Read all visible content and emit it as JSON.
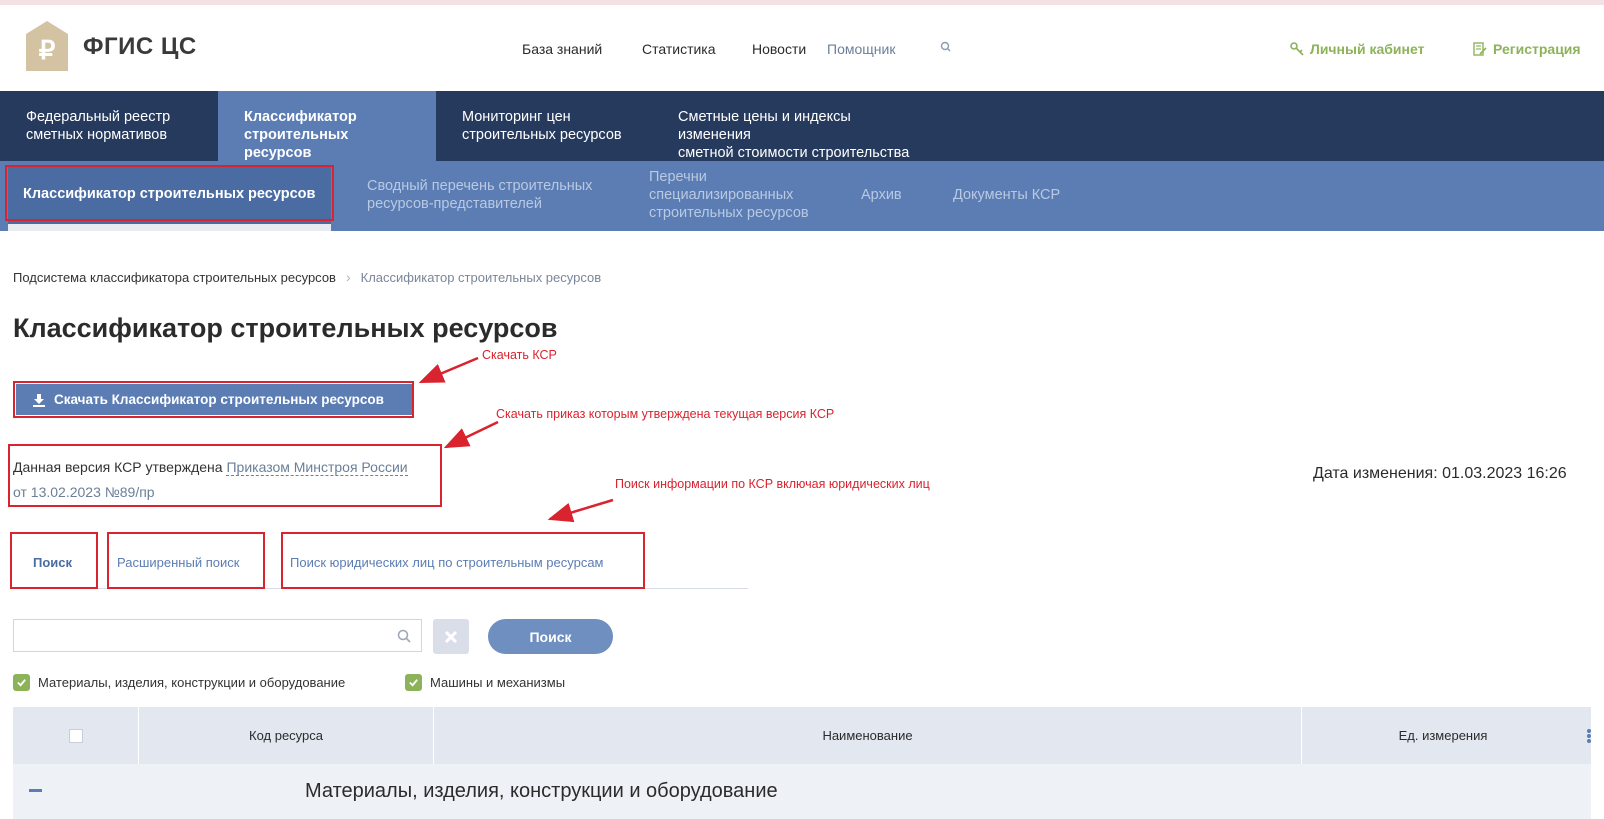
{
  "header": {
    "logo_title": "ФГИС ЦС",
    "nav": [
      "База знаний",
      "Статистика",
      "Новости",
      "Помощник"
    ],
    "account_label": "Личный кабинет",
    "register_label": "Регистрация"
  },
  "main_nav": [
    {
      "line1": "Федеральный реестр",
      "line2": "сметных нормативов"
    },
    {
      "line1": "Классификатор",
      "line2": "строительных ресурсов"
    },
    {
      "line1": "Мониторинг цен",
      "line2": "строительных ресурсов"
    },
    {
      "line1": "Сметные цены и индексы изменения",
      "line2": "сметной стоимости строительства"
    }
  ],
  "sub_nav": {
    "active": "Классификатор строительных ресурсов",
    "item1_line1": "Сводный перечень строительных",
    "item1_line2": "ресурсов-представителей",
    "item2_line1": "Перечни",
    "item2_line2": "специализированных",
    "item2_line3": "строительных ресурсов",
    "item3": "Архив",
    "item4": "Документы КСР"
  },
  "breadcrumb": {
    "root": "Подсистема классификатора строительных ресурсов",
    "current": "Классификатор строительных ресурсов"
  },
  "page_title": "Классификатор строительных ресурсов",
  "download_button": "Скачать Классификатор строительных ресурсов",
  "approved": {
    "prefix": "Данная версия КСР утверждена",
    "link": "Приказом Минстроя России",
    "link2": "от 13.02.2023 №89/пр"
  },
  "changed_label": "Дата изменения: 01.03.2023 16:26",
  "annotations": {
    "download": "Скачать КСР",
    "order": "Скачать приказ которым утверждена текущая версия КСР",
    "search": "Поиск информации по КСР включая юридических лиц"
  },
  "tabs": [
    "Поиск",
    "Расширенный поиск",
    "Поиск юридических лиц по строительным ресурсам"
  ],
  "search": {
    "value": "",
    "button": "Поиск"
  },
  "filters": [
    "Материалы, изделия, конструкции и оборудование",
    "Машины и механизмы"
  ],
  "table": {
    "columns": [
      "Код ресурса",
      "Наименование",
      "Ед. измерения"
    ],
    "group_row": "Материалы, изделия, конструкции и оборудование"
  },
  "colors": {
    "nav_dark": "#263a5e",
    "nav_blue": "#5b7db4",
    "accent_green": "#8db35a",
    "annotation_red": "#d9232e"
  }
}
